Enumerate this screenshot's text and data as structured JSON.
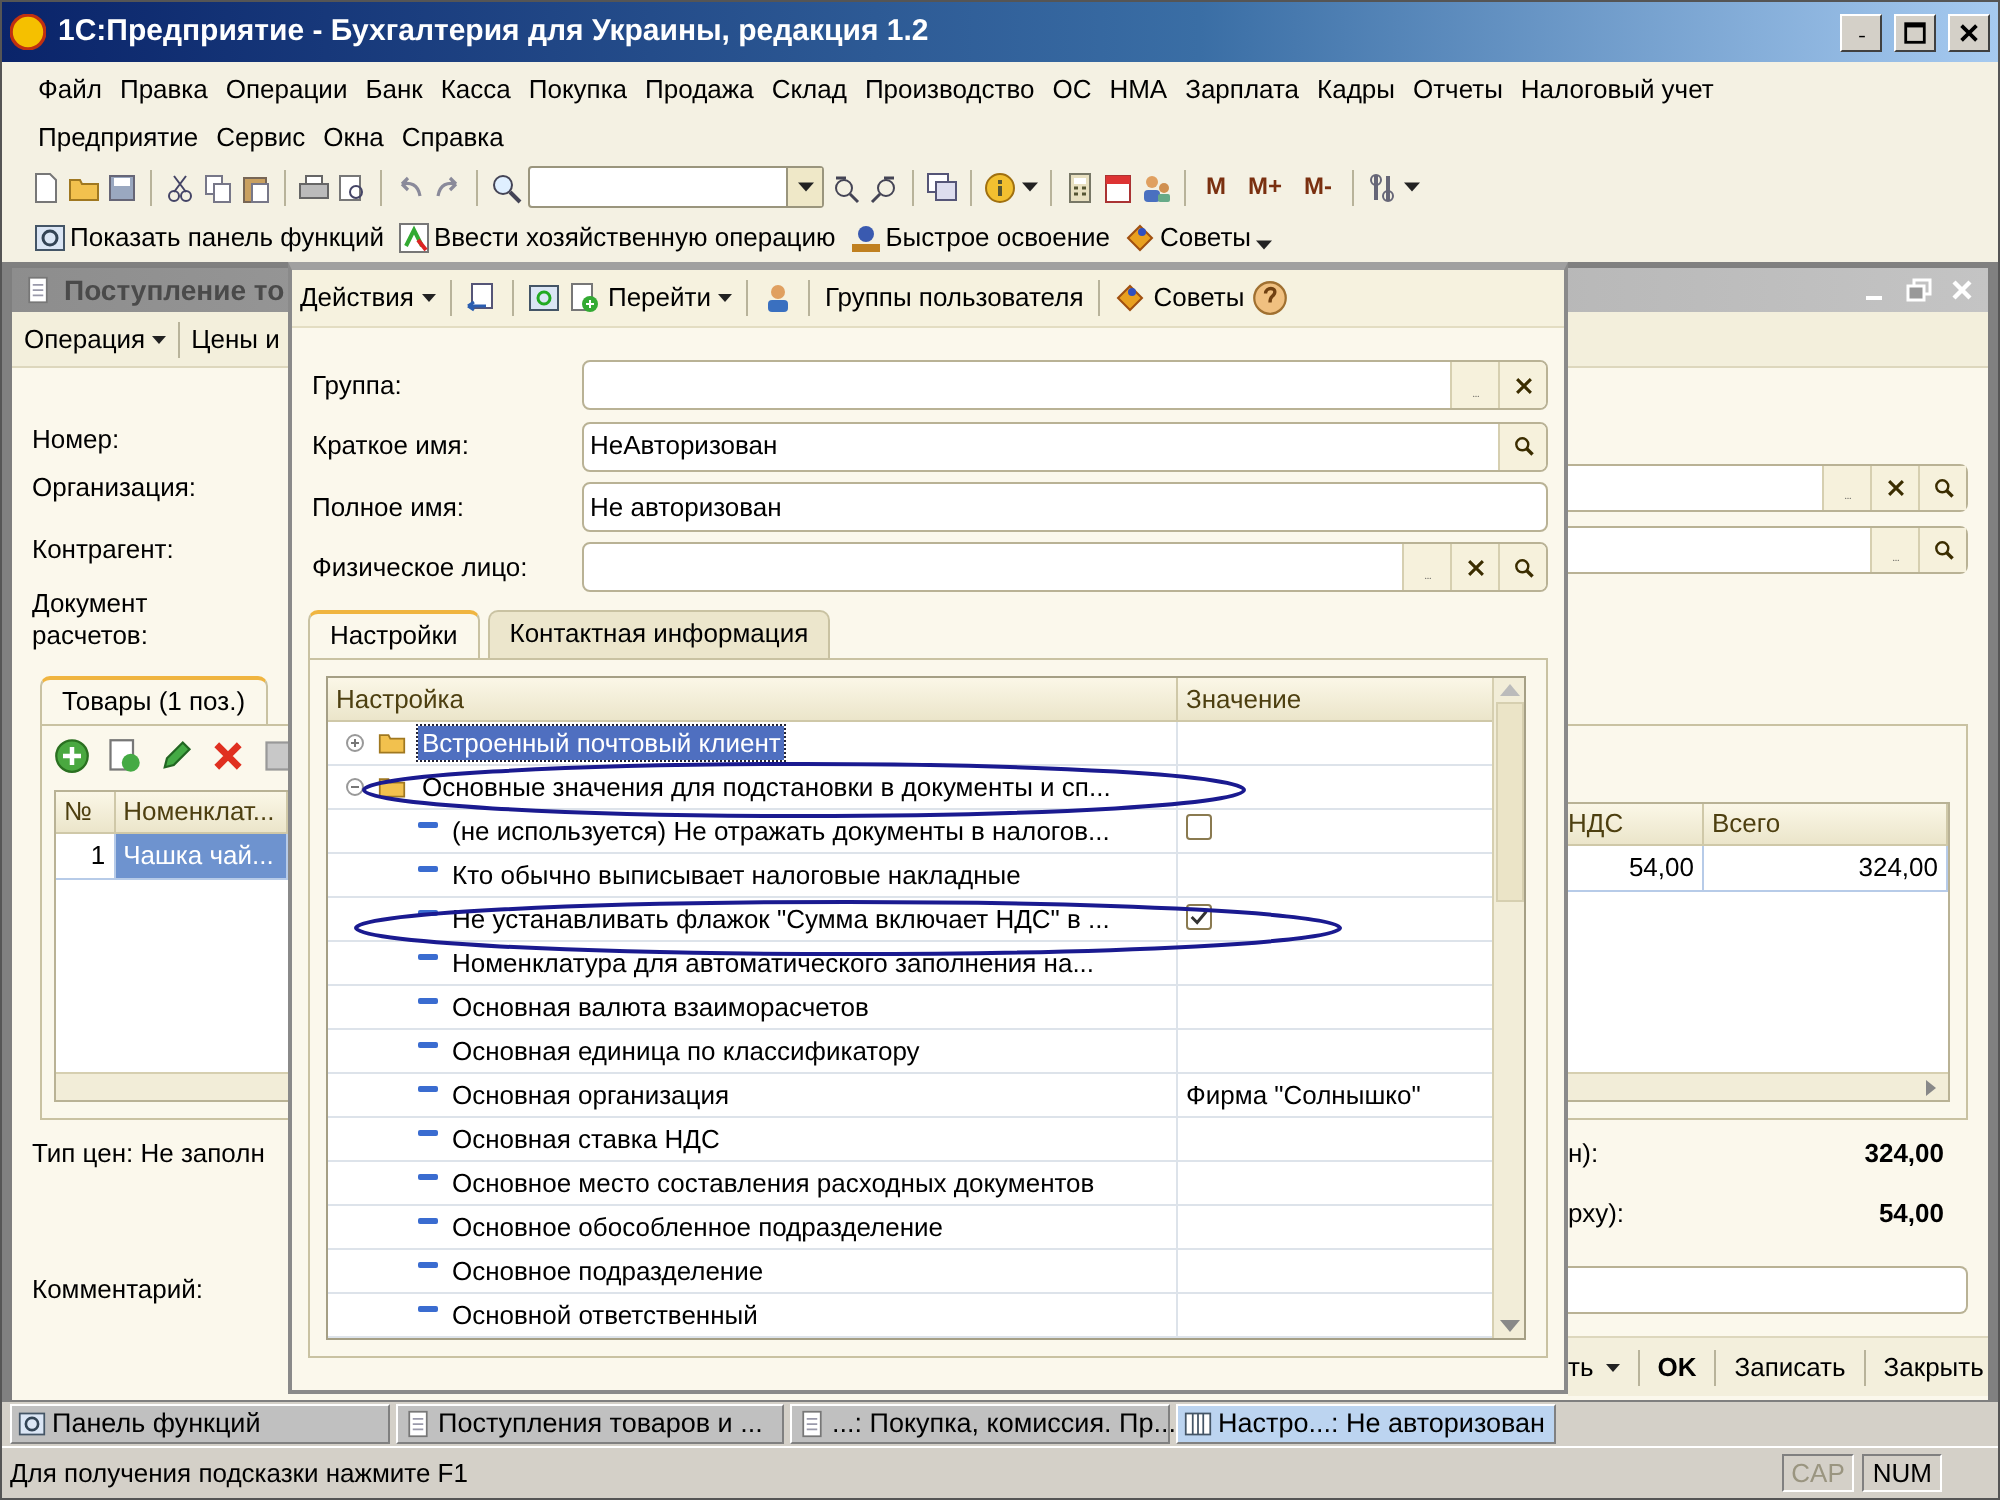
{
  "window": {
    "title": "1С:Предприятие - Бухгалтерия для Украины, редакция 1.2"
  },
  "menu_rows": [
    [
      "Файл",
      "Правка",
      "Операции",
      "Банк",
      "Касса",
      "Покупка",
      "Продажа",
      "Склад",
      "Производство",
      "ОС",
      "НМА",
      "Зарплата",
      "Кадры",
      "Отчеты",
      "Налоговый учет"
    ],
    [
      "Предприятие",
      "Сервис",
      "Окна",
      "Справка"
    ]
  ],
  "toolbar": {
    "memory_buttons": [
      "M",
      "M+",
      "M-"
    ]
  },
  "quick_toolbar": [
    {
      "label": "Показать панель функций",
      "dropdown": false
    },
    {
      "label": "Ввести хозяйственную операцию",
      "dropdown": false
    },
    {
      "label": "Быстрое освоение",
      "dropdown": false
    },
    {
      "label": "Советы",
      "dropdown": true
    }
  ],
  "document_window": {
    "title": "Поступление то",
    "toolbar": [
      {
        "label": "Операция",
        "dropdown": true
      },
      {
        "label": "Цены и",
        "dropdown": false
      }
    ],
    "fields": [
      {
        "label": "Номер:"
      },
      {
        "label": "Организация:"
      },
      {
        "label": "Контрагент:"
      },
      {
        "label": "Документ расчетов:"
      }
    ],
    "tabs": [
      {
        "label": "Товары (1 поз.)",
        "selected": true
      }
    ],
    "table": {
      "columns": [
        "№",
        "Номенклат...",
        "НДС",
        "Всего"
      ],
      "rows": [
        {
          "cells": [
            "1",
            "Чашка чай...",
            "54,00",
            "324,00"
          ],
          "selected": true
        }
      ]
    },
    "price_type": "Тип цен: Не заполн",
    "totals": [
      {
        "label": "н):",
        "value": "324,00"
      },
      {
        "label": "рху):",
        "value": "54,00"
      }
    ],
    "comment_label": "Комментарий:",
    "buttons": [
      {
        "label": "ть",
        "dropdown": true,
        "default": false
      },
      {
        "label": "OK",
        "dropdown": false,
        "default": true
      },
      {
        "label": "Записать",
        "dropdown": false,
        "default": false
      },
      {
        "label": "Закрыть",
        "dropdown": false,
        "default": false
      }
    ]
  },
  "dialog": {
    "toolbar": [
      {
        "label": "Действия",
        "dropdown": true
      },
      {
        "label": "Перейти",
        "dropdown": true
      },
      {
        "label": "Группы пользователя",
        "dropdown": false
      },
      {
        "label": "Советы",
        "dropdown": false
      }
    ],
    "fields": [
      {
        "label": "Группа:"
      },
      {
        "label": "Краткое имя:",
        "value": "НеАвторизован"
      },
      {
        "label": "Полное имя:",
        "value": "Не авторизован"
      },
      {
        "label": "Физическое лицо:"
      }
    ],
    "tabs": [
      {
        "label": "Настройки",
        "selected": true
      },
      {
        "label": "Контактная информация",
        "selected": false
      }
    ],
    "settings": {
      "columns": [
        "Настройка",
        "Значение"
      ],
      "rows": [
        {
          "kind": "folder",
          "label": "Встроенный почтовый клиент",
          "expanded": false,
          "selected": true,
          "circled": false
        },
        {
          "kind": "folder",
          "label": "Основные значения для подстановки в документы и сп...",
          "expanded": true,
          "selected": false,
          "circled": true,
          "children": [
            {
              "kind": "flag",
              "label": "(не используется) Не отражать документы в налогов...",
              "checked": false,
              "selected": false,
              "circled": false
            },
            {
              "kind": "setting",
              "label": "Кто обычно выписывает налоговые накладные",
              "selected": false,
              "circled": false
            },
            {
              "kind": "flag",
              "label": "Не устанавливать флажок \"Сумма включает НДС\" в ...",
              "checked": true,
              "selected": false,
              "circled": true
            },
            {
              "kind": "setting",
              "label": "Номенклатура для автоматического заполнения на...",
              "selected": false,
              "circled": false
            },
            {
              "kind": "setting",
              "label": "Основная валюта взаиморасчетов",
              "selected": false,
              "circled": false
            },
            {
              "kind": "setting",
              "label": "Основная единица по классификатору",
              "selected": false,
              "circled": false
            },
            {
              "kind": "setting",
              "label": "Основная организация",
              "value": "Фирма \"Солнышко\"",
              "selected": false,
              "circled": false
            },
            {
              "kind": "setting",
              "label": "Основная ставка НДС",
              "selected": false,
              "circled": false
            },
            {
              "kind": "setting",
              "label": "Основное место составления расходных документов",
              "selected": false,
              "circled": false
            },
            {
              "kind": "setting",
              "label": "Основное обособленное подразделение",
              "selected": false,
              "circled": false
            },
            {
              "kind": "setting",
              "label": "Основное подразделение",
              "selected": false,
              "circled": false
            },
            {
              "kind": "setting",
              "label": "Основной ответственный",
              "selected": false,
              "circled": false
            }
          ]
        }
      ]
    }
  },
  "taskbar": [
    {
      "label": "Панель функций",
      "selected": false
    },
    {
      "label": "Поступления товаров и ...",
      "selected": false
    },
    {
      "label": "...: Покупка, комиссия. Пр...",
      "selected": false
    },
    {
      "label": "Настро...: Не авторизован",
      "selected": true
    }
  ],
  "status_bar": {
    "text": "Для получения подсказки нажмите F1",
    "indicators": [
      {
        "label": "CAP",
        "on": false
      },
      {
        "label": "NUM",
        "on": true
      }
    ]
  }
}
